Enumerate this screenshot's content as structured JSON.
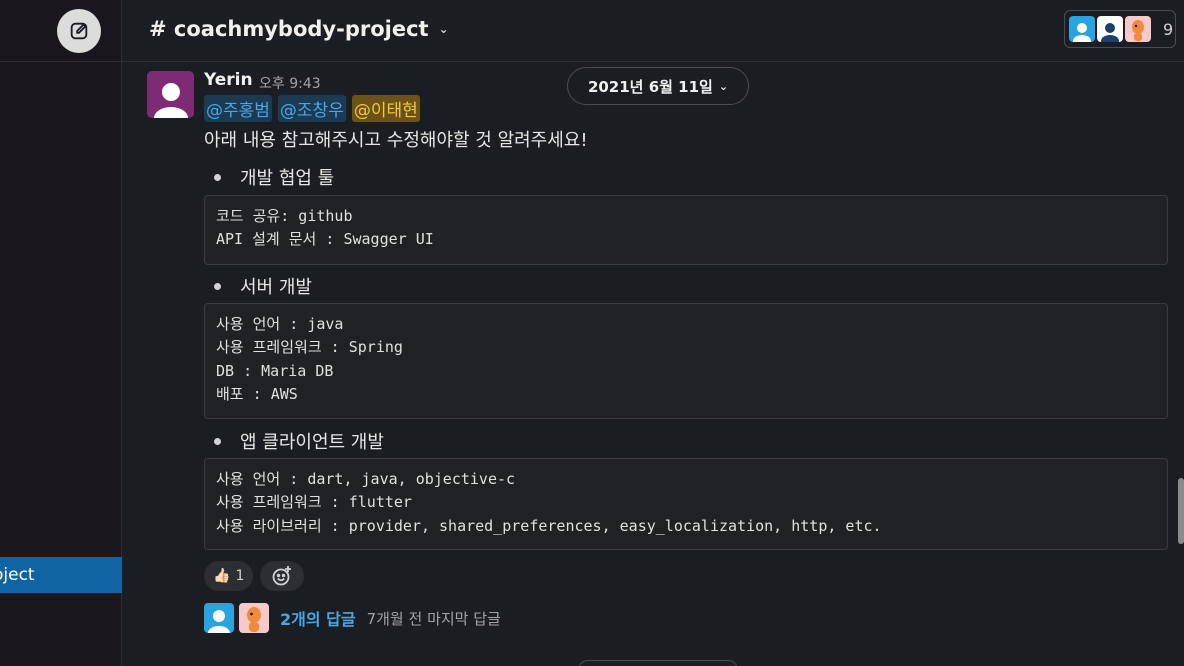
{
  "sidebar": {
    "compose_icon": "compose-icon",
    "active_item_label": "oject"
  },
  "header": {
    "channel_name": "# coachmybody-project",
    "member_count": "9"
  },
  "message": {
    "author": "Yerin",
    "time": "오후 9:43",
    "date_divider": "2021년 6월 11일",
    "mentions": [
      "@주홍범",
      "@조창우",
      "@이태현"
    ],
    "text": "아래 내용 참고해주시고 수정해야할 것 알려주세요!",
    "sections": [
      {
        "title": "개발 협업 툴",
        "code": [
          "코드 공유: github",
          "API 설계 문서 : Swagger UI"
        ]
      },
      {
        "title": "서버 개발",
        "code": [
          "사용 언어 : java",
          "사용 프레임워크 : Spring",
          "DB : Maria DB",
          "배포 : AWS"
        ]
      },
      {
        "title": "앱 클라이언트 개발",
        "code": [
          "사용 언어 : dart, java, objective-c",
          "사용 프레임워크 : flutter",
          "사용 라이브러리 : provider, shared_preferences, easy_localization, http, etc."
        ]
      }
    ],
    "reaction": {
      "emoji": "👍🏻",
      "count": "1"
    },
    "thread": {
      "reply_count": "2개의 답글",
      "last_reply": "7개월 전 마지막 답글"
    }
  },
  "colors": {
    "background": "#1a1d21",
    "active_item": "#1164a3",
    "mention": "#4aa6e6",
    "self_mention": "#f2c744",
    "avatar": "#7d2b73"
  }
}
